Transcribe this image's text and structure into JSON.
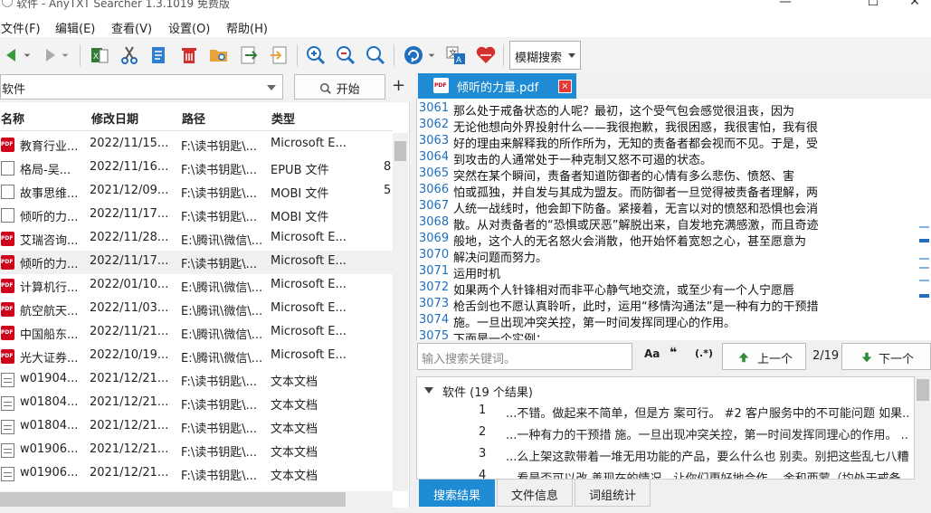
{
  "window": {
    "title": "软件 - AnyTXT Searcher 1.3.1019 免费版",
    "min": "—",
    "max": "☐",
    "close": "✕"
  },
  "menu": [
    "文件(F)",
    "编辑(E)",
    "查看(V)",
    "设置(O)",
    "帮助(H)"
  ],
  "toolbar": {
    "search_mode": "模糊搜索"
  },
  "filter": {
    "query": "软件",
    "start_label": "开始",
    "add_label": "+"
  },
  "columns": {
    "name": "名称",
    "date": "修改日期",
    "path": "路径",
    "type": "类型"
  },
  "files": [
    {
      "icon": "pdf",
      "name": "教育行业...",
      "date": "2022/11/15...",
      "path": "F:\\读书钥匙\\...",
      "type": "Microsoft E...",
      "extra": ""
    },
    {
      "icon": "doc",
      "name": "格局-吴...",
      "date": "2022/11/16...",
      "path": "F:\\读书钥匙\\...",
      "type": "EPUB 文件",
      "extra": "8"
    },
    {
      "icon": "doc",
      "name": "故事思维...",
      "date": "2021/12/09...",
      "path": "F:\\读书钥匙\\...",
      "type": "MOBI 文件",
      "extra": "5"
    },
    {
      "icon": "doc",
      "name": "倾听的力...",
      "date": "2022/11/17...",
      "path": "F:\\读书钥匙\\...",
      "type": "MOBI 文件",
      "extra": ""
    },
    {
      "icon": "pdf",
      "name": "艾瑞咨询...",
      "date": "2022/11/28...",
      "path": "E:\\腾讯\\微信\\...",
      "type": "Microsoft E...",
      "extra": ""
    },
    {
      "icon": "pdf",
      "name": "倾听的力...",
      "date": "2022/11/17...",
      "path": "F:\\读书钥匙\\...",
      "type": "Microsoft E...",
      "extra": "",
      "selected": true
    },
    {
      "icon": "pdf",
      "name": "计算机行...",
      "date": "2022/01/10...",
      "path": "E:\\腾讯\\微信\\...",
      "type": "Microsoft E...",
      "extra": ""
    },
    {
      "icon": "pdf",
      "name": "航空航天...",
      "date": "2022/11/03...",
      "path": "E:\\腾讯\\微信\\...",
      "type": "Microsoft E...",
      "extra": ""
    },
    {
      "icon": "pdf",
      "name": "中国船东...",
      "date": "2022/11/21...",
      "path": "E:\\腾讯\\微信\\...",
      "type": "Microsoft E...",
      "extra": ""
    },
    {
      "icon": "pdf",
      "name": "光大证券...",
      "date": "2022/10/19...",
      "path": "E:\\腾讯\\微信\\...",
      "type": "Microsoft E...",
      "extra": ""
    },
    {
      "icon": "txt",
      "name": "w01904...",
      "date": "2021/12/21...",
      "path": "F:\\读书钥匙\\...",
      "type": "文本文档",
      "extra": ""
    },
    {
      "icon": "txt",
      "name": "w01804...",
      "date": "2021/12/21...",
      "path": "F:\\读书钥匙\\...",
      "type": "文本文档",
      "extra": ""
    },
    {
      "icon": "txt",
      "name": "w01804...",
      "date": "2021/12/21...",
      "path": "F:\\读书钥匙\\...",
      "type": "文本文档",
      "extra": ""
    },
    {
      "icon": "txt",
      "name": "w01906...",
      "date": "2021/12/21...",
      "path": "F:\\读书钥匙\\...",
      "type": "文本文档",
      "extra": ""
    },
    {
      "icon": "txt",
      "name": "w01906...",
      "date": "2021/12/21...",
      "path": "F:\\读书钥匙\\...",
      "type": "文本文档",
      "extra": ""
    }
  ],
  "doc_tab": {
    "label": "倾听的力量.pdf",
    "close": "×"
  },
  "text_lines": [
    {
      "n": "3061",
      "t": "那么处于戒备状态的人呢？最初，这个受气包会感觉很沮丧，因为"
    },
    {
      "n": "3062",
      "t": "无论他想向外界投射什么——我很抱歉，我很困惑，我很害怕，我有很"
    },
    {
      "n": "3063",
      "t": "好的理由来解释我的所作所为，无知的责备者都会视而不见。于是，受"
    },
    {
      "n": "3064",
      "t": "到攻击的人通常处于一种克制又怒不可遏的状态。"
    },
    {
      "n": "3065",
      "t": "突然在某个瞬间，责备者知道防御者的心情有多么悲伤、愤怒、害"
    },
    {
      "n": "3066",
      "t": "怕或孤独，并自发与其成为盟友。而防御者一旦觉得被责备者理解，两"
    },
    {
      "n": "3067",
      "t": "人统一战线时，他会卸下防备。紧接着，无言以对的愤怒和恐惧也会消"
    },
    {
      "n": "3068",
      "t": "散。从对责备者的“恐惧或厌恶”解脱出来，自发地充满感激，而且奇迹"
    },
    {
      "n": "3069",
      "t": "般地，这个人的无名怒火会消散，他开始怀着宽恕之心，甚至愿意为"
    },
    {
      "n": "3070",
      "t": "解决问题而努力。"
    },
    {
      "n": "3071",
      "t": "运用时机"
    },
    {
      "n": "3072",
      "t": "如果两个人针锋相对而非平心静气地交流，或至少有一个人宁愿唇"
    },
    {
      "n": "3073",
      "t": "枪舌剑也不愿认真聆听，此时，运用“移情沟通法”是一种有力的干预措"
    },
    {
      "n": "3074",
      "t": "施。一旦出现冲突关控，第一时间发挥同理心的作用。"
    },
    {
      "n": "3075",
      "t": "下面是一个实例："
    }
  ],
  "search": {
    "placeholder": "输入搜索关键词。",
    "case_btn": "Aa",
    "quote_btn": "❝",
    "regex_btn": "(.*)",
    "prev_label": "上一个",
    "counter": "2/19",
    "next_label": "下一个"
  },
  "results": {
    "group_label": "软件 (19 个结果)",
    "items": [
      {
        "n": "1",
        "snippet": "...不错。做起来不简单，但是方 案可行。 #2 客户服务中的不可能问题 如果..."
      },
      {
        "n": "2",
        "snippet": "...一种有力的干预措 施。一旦出现冲突关控，第一时间发挥同理心的作用。 ..."
      },
      {
        "n": "3",
        "snippet": "...么上架这款带着一堆无用功能的产品，要么什么也 别卖。别把这些乱七八糟..."
      },
      {
        "n": "4",
        "snippet": "...看是否可以改 善现在的情况，让你们更好地合作。 金和西蒙（均处于戒备..."
      }
    ]
  },
  "bottom_tabs": [
    "搜索结果",
    "文件信息",
    "词组统计"
  ],
  "colors": {
    "accent": "#1e8bd4",
    "pdf_red": "#d0021b",
    "line_number": "#1e6fbf"
  }
}
